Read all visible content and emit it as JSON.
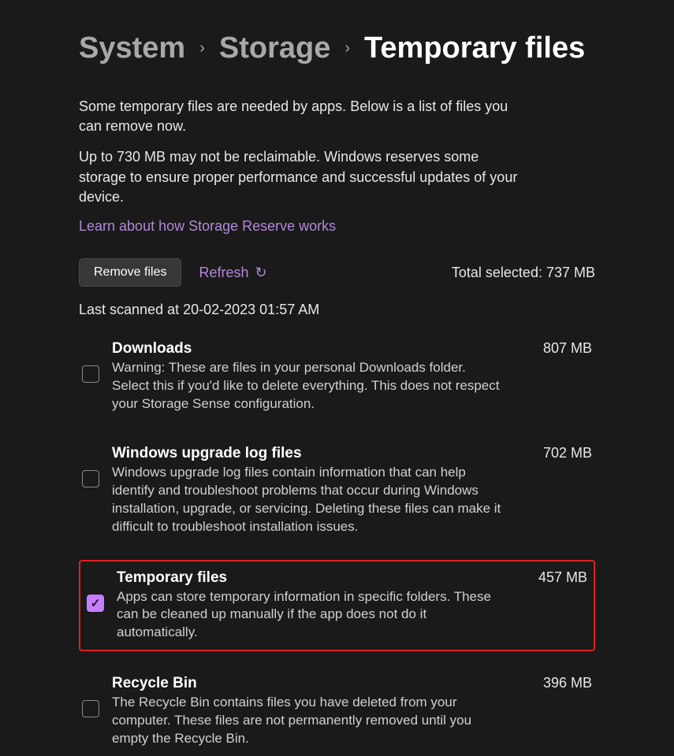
{
  "breadcrumb": {
    "items": [
      "System",
      "Storage",
      "Temporary files"
    ]
  },
  "intro": {
    "p1": "Some temporary files are needed by apps. Below is a list of files you can remove now.",
    "p2": "Up to 730 MB may not be reclaimable. Windows reserves some storage to ensure proper performance and successful updates of your device.",
    "link": "Learn about how Storage Reserve works"
  },
  "toolbar": {
    "remove_label": "Remove files",
    "refresh_label": "Refresh",
    "total_selected": "Total selected: 737 MB"
  },
  "last_scanned": "Last scanned at 20-02-2023 01:57 AM",
  "items": [
    {
      "title": "Downloads",
      "size": "807 MB",
      "desc": "Warning: These are files in your personal Downloads folder. Select this if you'd like to delete everything. This does not respect your Storage Sense configuration.",
      "checked": false,
      "highlighted": false
    },
    {
      "title": "Windows upgrade log files",
      "size": "702 MB",
      "desc": "Windows upgrade log files contain information that can help identify and troubleshoot problems that occur during Windows installation, upgrade, or servicing.  Deleting these files can make it difficult to troubleshoot installation issues.",
      "checked": false,
      "highlighted": false
    },
    {
      "title": "Temporary files",
      "size": "457 MB",
      "desc": "Apps can store temporary information in specific folders. These can be cleaned up manually if the app does not do it automatically.",
      "checked": true,
      "highlighted": true
    },
    {
      "title": "Recycle Bin",
      "size": "396 MB",
      "desc": "The Recycle Bin contains files you have deleted from your computer. These files are not permanently removed until you empty the Recycle Bin.",
      "checked": false,
      "highlighted": false
    }
  ]
}
